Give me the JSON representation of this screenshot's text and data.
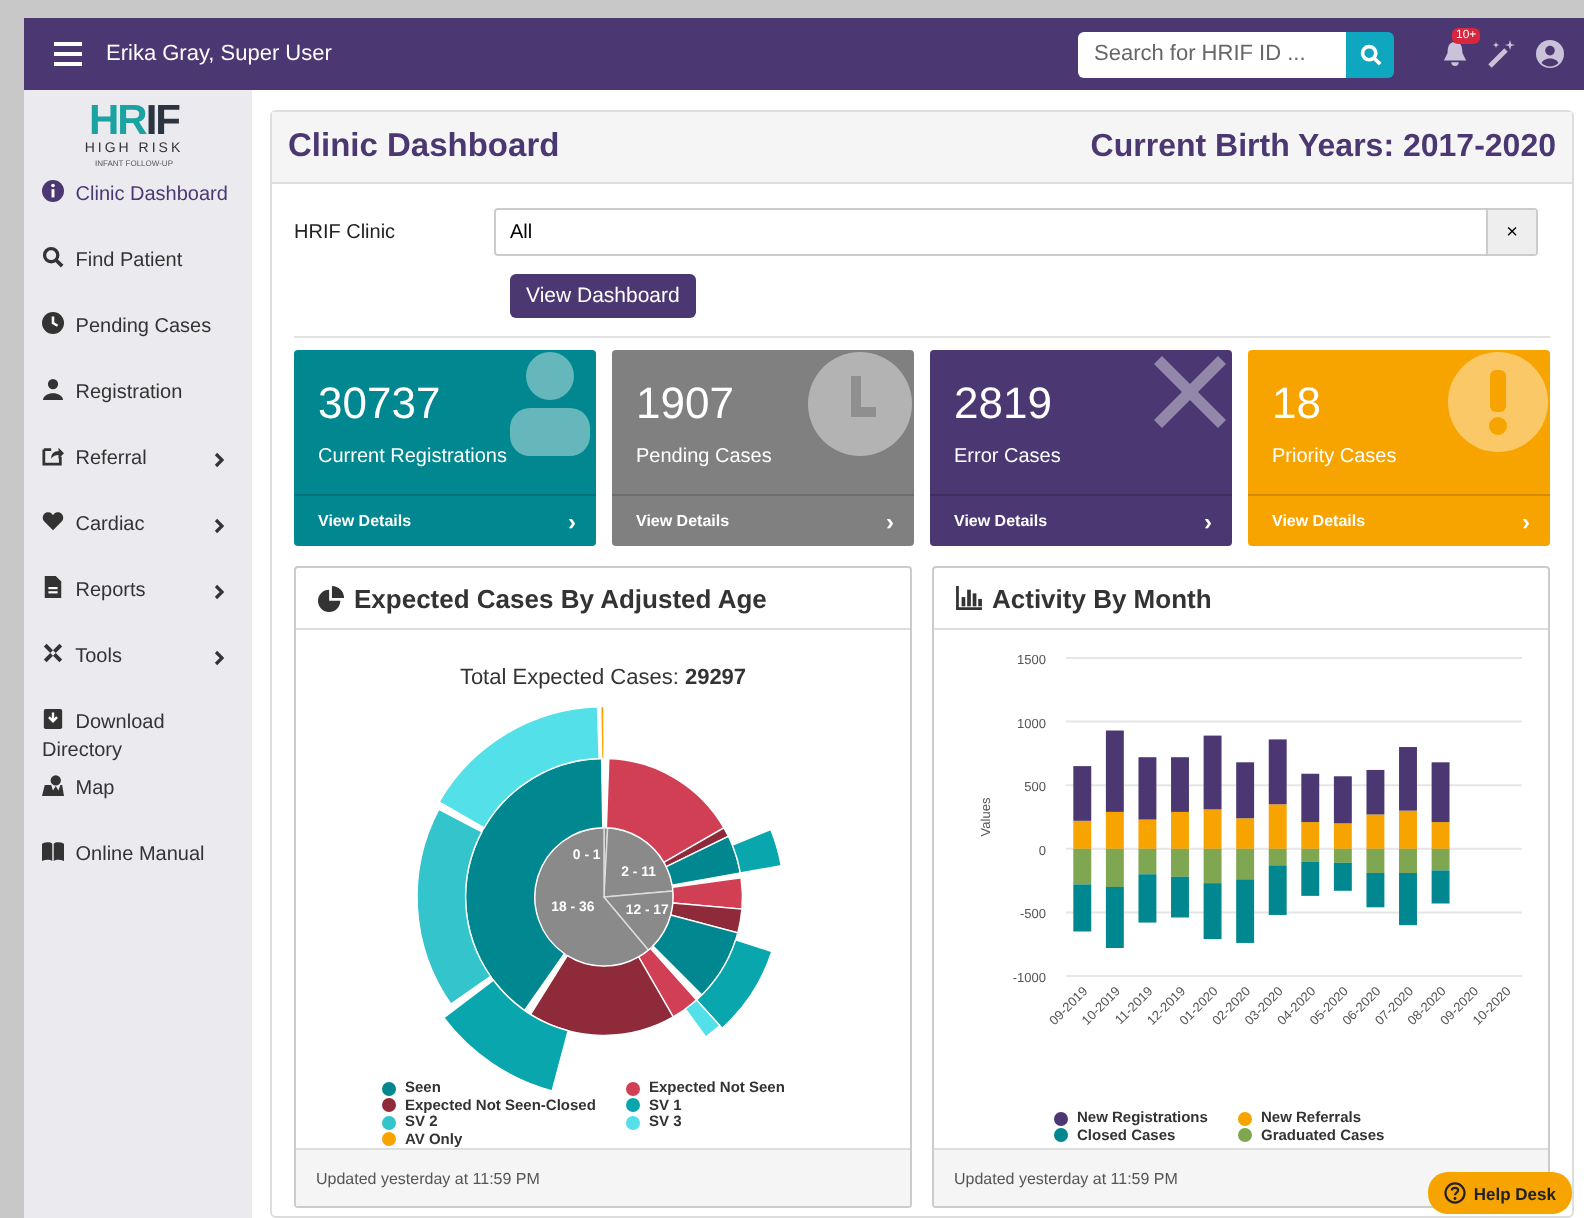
{
  "navbar": {
    "user": "Erika Gray, Super User",
    "search": {
      "placeholder": "Search for HRIF ID ..."
    },
    "notification_badge": "10+"
  },
  "logo": {
    "mark": "HRIF",
    "name": "HIGH RISK",
    "tagline": "INFANT FOLLOW-UP"
  },
  "sidebar": {
    "items": [
      {
        "label": "Clinic Dashboard",
        "selected": true,
        "has_submenu": false
      },
      {
        "label": "Find Patient",
        "selected": false,
        "has_submenu": false
      },
      {
        "label": "Pending Cases",
        "selected": false,
        "has_submenu": false
      },
      {
        "label": "Registration",
        "selected": false,
        "has_submenu": false
      },
      {
        "label": "Referral",
        "selected": false,
        "has_submenu": true
      },
      {
        "label": "Cardiac",
        "selected": false,
        "has_submenu": true
      },
      {
        "label": "Reports",
        "selected": false,
        "has_submenu": true
      },
      {
        "label": "Tools",
        "selected": false,
        "has_submenu": true
      },
      {
        "label": "Download Directory",
        "selected": false,
        "has_submenu": false
      },
      {
        "label": "Map",
        "selected": false,
        "has_submenu": false
      },
      {
        "label": "Online Manual",
        "selected": false,
        "has_submenu": false
      }
    ]
  },
  "header": {
    "title": "Clinic Dashboard",
    "birth_years": "Current Birth Years: 2017-2020"
  },
  "filter": {
    "label": "HRIF Clinic",
    "value": "All",
    "clear": "×",
    "button": "View Dashboard"
  },
  "cards": [
    {
      "count": "30737",
      "label": "Current Registrations",
      "link": "View Details",
      "chevron": "›",
      "color": "#00878f"
    },
    {
      "count": "1907",
      "label": "Pending Cases",
      "link": "View Details",
      "chevron": "›",
      "color": "#808080"
    },
    {
      "count": "2819",
      "label": "Error Cases",
      "link": "View Details",
      "chevron": "›",
      "color": "#4b3872"
    },
    {
      "count": "18",
      "label": "Priority Cases",
      "link": "View Details",
      "chevron": "›",
      "color": "#f7a400"
    }
  ],
  "expected_panel": {
    "title": "Expected Cases By Adjusted Age",
    "total": "Total Expected Cases: **29297**",
    "ring_labels": [
      "0 - 1",
      "2 - 11",
      "18 - 36",
      "12 - 17"
    ],
    "legend": [
      {
        "label": "Seen",
        "color": "#00878f"
      },
      {
        "label": "Expected Not Seen",
        "color": "#d13f54"
      },
      {
        "label": "Expected Not Seen-Closed",
        "color": "#8e2a3a"
      },
      {
        "label": "SV 1",
        "color": "#0aa6ad"
      },
      {
        "label": "SV 2",
        "color": "#33c4cc"
      },
      {
        "label": "SV 3",
        "color": "#54e0e8"
      },
      {
        "label": "AV Only",
        "color": "#f7a400"
      }
    ],
    "footer": "Updated yesterday at 11:59 PM"
  },
  "activity_panel": {
    "title": "Activity By Month",
    "footer": "Updated yesterday at 11:59 PM",
    "chart_data": {
      "type": "bar",
      "stacked": true,
      "grid": true,
      "ylabel": "Values",
      "ylim": [
        -1000,
        1500
      ],
      "yticks": [
        -1000,
        -500,
        0,
        500,
        1000,
        1500
      ],
      "categories": [
        "09-2019",
        "10-2019",
        "11-2019",
        "12-2019",
        "01-2020",
        "02-2020",
        "03-2020",
        "04-2020",
        "05-2020",
        "06-2020",
        "07-2020",
        "08-2020",
        "09-2020",
        "10-2020"
      ],
      "series": [
        {
          "name": "New Registrations",
          "color": "#4b3872",
          "values": [
            430,
            640,
            490,
            430,
            580,
            440,
            510,
            380,
            370,
            350,
            500,
            470,
            null,
            null
          ]
        },
        {
          "name": "New Referrals",
          "color": "#f7a400",
          "values": [
            220,
            290,
            230,
            290,
            310,
            240,
            350,
            210,
            200,
            270,
            300,
            210,
            null,
            null
          ]
        },
        {
          "name": "Closed Cases",
          "color": "#00878f",
          "values": [
            -370,
            -480,
            -380,
            -320,
            -440,
            -500,
            -390,
            -270,
            -220,
            -270,
            -410,
            -260,
            null,
            null
          ]
        },
        {
          "name": "Graduated Cases",
          "color": "#7fa650",
          "values": [
            -280,
            -300,
            -200,
            -220,
            -270,
            -240,
            -130,
            -100,
            -110,
            -190,
            -190,
            -170,
            null,
            null
          ]
        }
      ]
    }
  },
  "help_desk": {
    "label": "Help Desk"
  }
}
